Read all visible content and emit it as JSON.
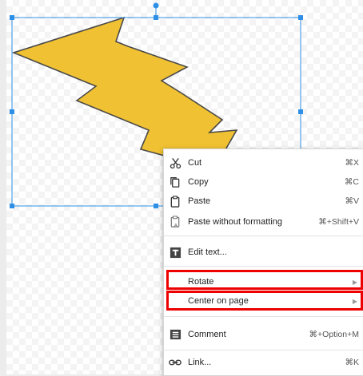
{
  "menu": {
    "items": [
      {
        "id": "cut",
        "label": "Cut",
        "shortcut": "⌘X",
        "icon": "scissors-icon"
      },
      {
        "id": "copy",
        "label": "Copy",
        "shortcut": "⌘C",
        "icon": "copy-icon"
      },
      {
        "id": "paste",
        "label": "Paste",
        "shortcut": "⌘V",
        "icon": "paste-icon"
      },
      {
        "id": "paste-plain",
        "label": "Paste without formatting",
        "shortcut": "⌘+Shift+V",
        "icon": "paste-plain-icon"
      },
      {
        "id": "edit-text",
        "label": "Edit text...",
        "shortcut": "",
        "icon": "text-box-icon"
      },
      {
        "id": "rotate",
        "label": "Rotate",
        "shortcut": "",
        "submenu": true
      },
      {
        "id": "center",
        "label": "Center on page",
        "shortcut": "",
        "submenu": true
      },
      {
        "id": "comment",
        "label": "Comment",
        "shortcut": "⌘+Option+M",
        "icon": "comment-icon"
      },
      {
        "id": "link",
        "label": "Link...",
        "shortcut": "⌘K",
        "icon": "link-icon"
      }
    ]
  },
  "shape": {
    "fill": "#f0c132",
    "stroke": "#4a4a4a"
  },
  "colors": {
    "selection": "#2e8fe6",
    "highlight": "#ee0000"
  }
}
